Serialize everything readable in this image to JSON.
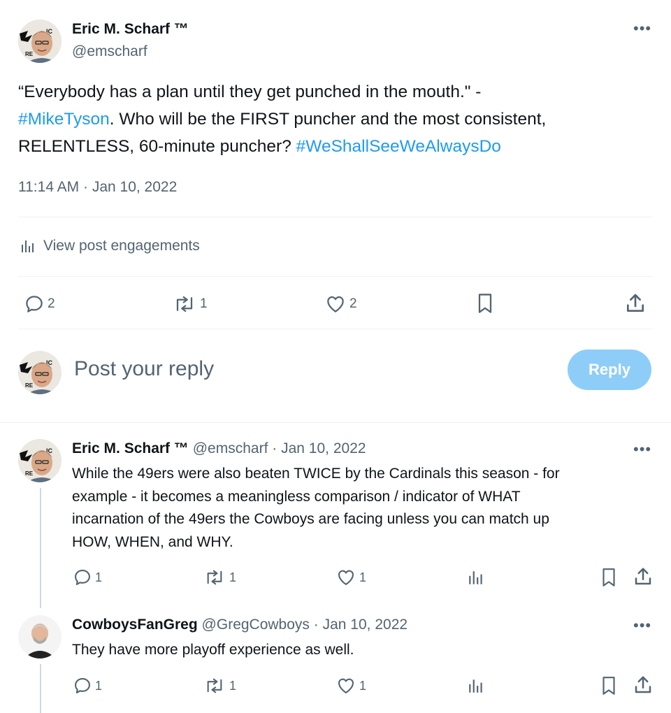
{
  "main_post": {
    "author_name": "Eric M. Scharf ™",
    "author_handle": "@emscharf",
    "text_part1": "“Everybody has a plan until they get punched in the mouth.\" -",
    "hashtag1": "#MikeTyson",
    "text_part2": ". Who will be the FIRST puncher and the most consistent,",
    "text_part3": "RELENTLESS, 60-minute puncher? ",
    "hashtag2": "#WeShallSeeWeAlwaysDo",
    "timestamp": "11:14 AM · Jan 10, 2022",
    "engagements_label": "View post engagements",
    "replies": "2",
    "reposts": "1",
    "likes": "2",
    "more_icon": "more-icon"
  },
  "reply_box": {
    "placeholder": "Post your reply",
    "button_label": "Reply",
    "button_color": "#8ecdf8"
  },
  "replies": [
    {
      "author_name": "Eric M. Scharf ™",
      "author_handle": "@emscharf",
      "date": "Jan 10, 2022",
      "lines": [
        "While the 49ers were also beaten TWICE by the Cardinals this season - for",
        "example - it becomes a meaningless comparison / indicator of WHAT",
        "incarnation of the 49ers the Cowboys are facing unless you can match up",
        "HOW, WHEN, and WHY."
      ],
      "replies": "1",
      "reposts": "1",
      "likes": "1"
    },
    {
      "author_name": "CowboysFanGreg",
      "author_handle": "@GregCowboys",
      "date": "Jan 10, 2022",
      "lines": [
        "They have more playoff experience as well."
      ],
      "replies": "1",
      "reposts": "1",
      "likes": "1"
    }
  ],
  "colors": {
    "accent": "#1d9bf0",
    "muted": "#536471",
    "divider": "#eff3f4"
  }
}
